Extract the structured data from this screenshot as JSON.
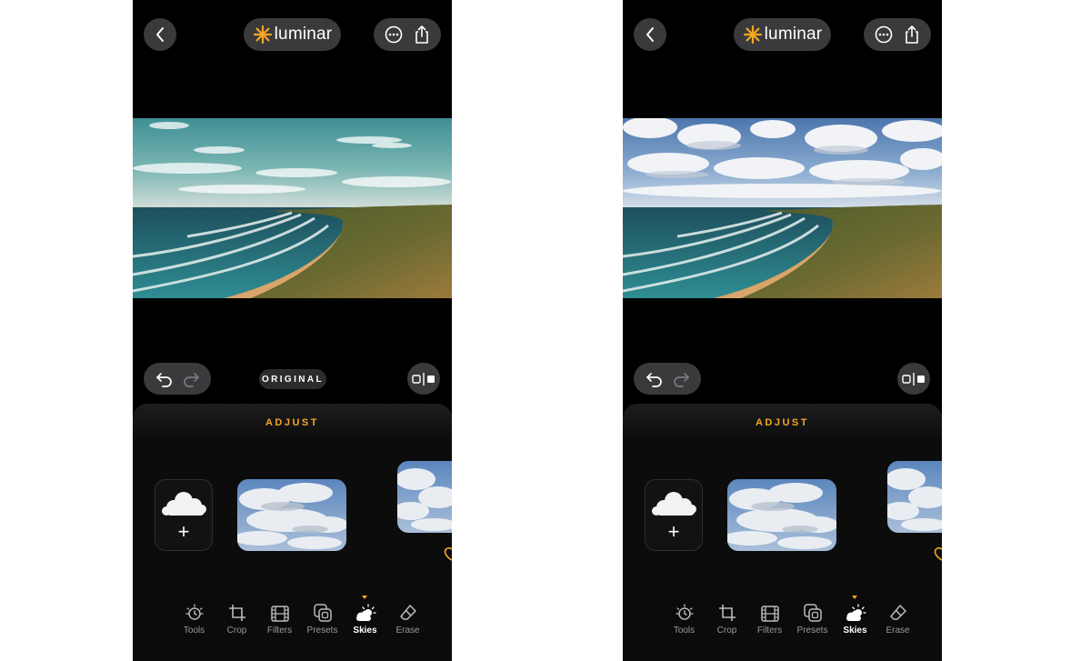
{
  "colors": {
    "accent": "#f5a623",
    "background": "#000000",
    "pill": "#3a3a3c"
  },
  "screens": [
    {
      "header": {
        "logo_text": "luminar",
        "back_icon": "chevron-left-icon",
        "more_icon": "ellipsis-circle-icon",
        "share_icon": "share-icon"
      },
      "photo": "original beach photo with teal sky",
      "edit_bar": {
        "original_label": "ORIGINAL",
        "undo_icon": "undo-icon",
        "redo_icon": "redo-icon",
        "compare_icon": "split-compare-icon"
      },
      "panel": {
        "title": "ADJUST",
        "add_sky_icon": "cloud-plus-icon",
        "add_symbol": "+"
      },
      "toolbar": [
        {
          "label": "Tools",
          "icon": "tools-icon",
          "active": false
        },
        {
          "label": "Crop",
          "icon": "crop-icon",
          "active": false
        },
        {
          "label": "Filters",
          "icon": "film-icon",
          "active": false
        },
        {
          "label": "Presets",
          "icon": "presets-icon",
          "active": false
        },
        {
          "label": "Skies",
          "icon": "sky-icon",
          "active": true
        },
        {
          "label": "Erase",
          "icon": "eraser-icon",
          "active": false
        }
      ]
    },
    {
      "header": {
        "logo_text": "luminar",
        "back_icon": "chevron-left-icon",
        "more_icon": "ellipsis-circle-icon",
        "share_icon": "share-icon"
      },
      "photo": "edited beach photo with cloudy sky",
      "edit_bar": {
        "undo_icon": "undo-icon",
        "redo_icon": "redo-icon",
        "compare_icon": "split-compare-icon"
      },
      "panel": {
        "title": "ADJUST",
        "add_sky_icon": "cloud-plus-icon",
        "add_symbol": "+"
      },
      "toolbar": [
        {
          "label": "Tools",
          "icon": "tools-icon",
          "active": false
        },
        {
          "label": "Crop",
          "icon": "crop-icon",
          "active": false
        },
        {
          "label": "Filters",
          "icon": "film-icon",
          "active": false
        },
        {
          "label": "Presets",
          "icon": "presets-icon",
          "active": false
        },
        {
          "label": "Skies",
          "icon": "sky-icon",
          "active": true
        },
        {
          "label": "Erase",
          "icon": "eraser-icon",
          "active": false
        }
      ]
    }
  ]
}
